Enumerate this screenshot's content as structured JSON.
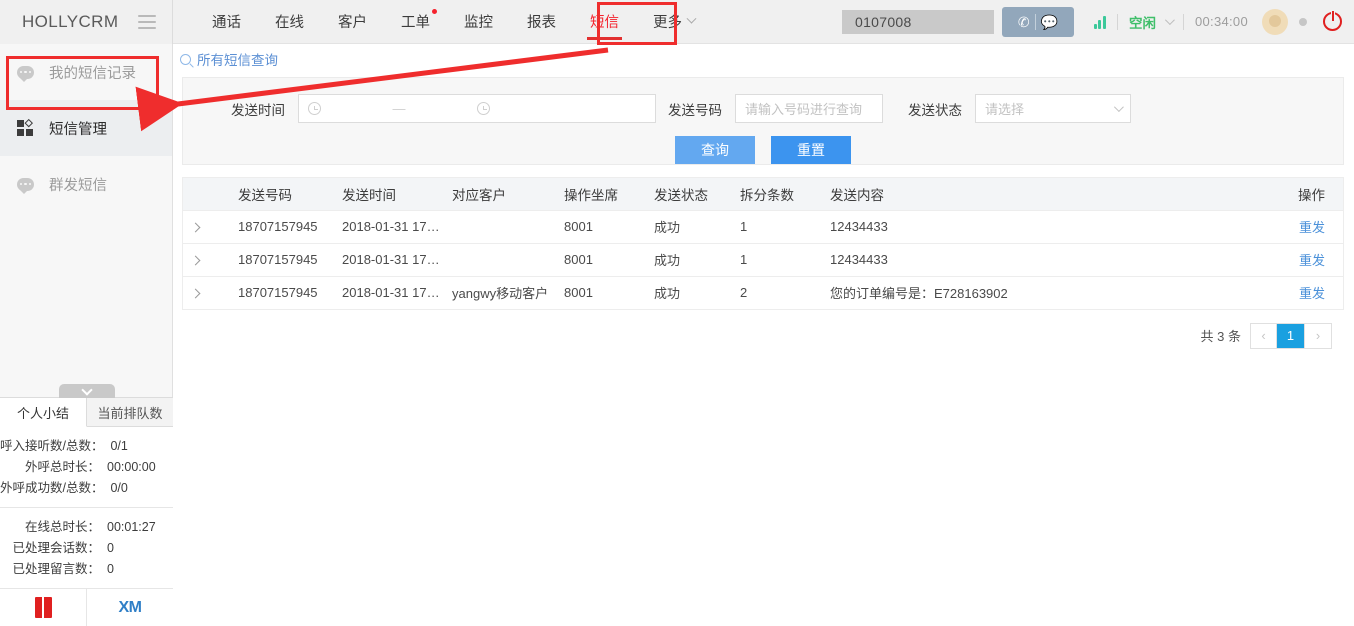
{
  "header": {
    "brand": "HOLLYCRM",
    "menu_icon": "hamburger-icon",
    "nav": [
      {
        "label": "通话",
        "active": false,
        "badge": false
      },
      {
        "label": "在线",
        "active": false,
        "badge": false
      },
      {
        "label": "客户",
        "active": false,
        "badge": false
      },
      {
        "label": "工单",
        "active": false,
        "badge": true
      },
      {
        "label": "监控",
        "active": false,
        "badge": false
      },
      {
        "label": "报表",
        "active": false,
        "badge": false
      },
      {
        "label": "短信",
        "active": true,
        "badge": false
      },
      {
        "label": "更多",
        "active": false,
        "badge": false
      }
    ],
    "extension": "0107008",
    "phone_icon": "phone-icon",
    "chat_icon": "chat-icon",
    "signal_icon": "wifi-signal-icon",
    "agent_status": "空闲",
    "timer": "00:34:00",
    "avatar": "user-avatar",
    "presence_dot": "presence-dot",
    "power_icon": "power-icon"
  },
  "sidebar": {
    "items": [
      {
        "label": "我的短信记录",
        "icon": "message-bubble-icon",
        "active": false
      },
      {
        "label": "短信管理",
        "icon": "grid-squares-icon",
        "active": true
      },
      {
        "label": "群发短信",
        "icon": "broadcast-bubble-icon",
        "active": false
      }
    ]
  },
  "breadcrumb": {
    "icon": "search-icon",
    "label": "所有短信查询"
  },
  "filter": {
    "time_label": "发送时间",
    "time_start_placeholder": "",
    "time_end_placeholder": "",
    "time_separator": "—",
    "number_label": "发送号码",
    "number_placeholder": "请输入号码进行查询",
    "number_value": "",
    "status_label": "发送状态",
    "status_placeholder": "请选择",
    "status_value": "",
    "query_button": "查询",
    "reset_button": "重置"
  },
  "table": {
    "columns": [
      "",
      "发送号码",
      "发送时间",
      "对应客户",
      "操作坐席",
      "发送状态",
      "拆分条数",
      "发送内容",
      "操作"
    ],
    "rows": [
      {
        "expand": "chevron-right",
        "number": "18707157945",
        "time": "2018-01-31 17:1...",
        "customer": "",
        "seat": "8001",
        "status": "成功",
        "split": "1",
        "content": "12434433",
        "action": "重发"
      },
      {
        "expand": "chevron-right",
        "number": "18707157945",
        "time": "2018-01-31 17:1...",
        "customer": "",
        "seat": "8001",
        "status": "成功",
        "split": "1",
        "content": "12434433",
        "action": "重发"
      },
      {
        "expand": "chevron-right",
        "number": "18707157945",
        "time": "2018-01-31 17:0...",
        "customer": "yangwy移动客户",
        "seat": "8001",
        "status": "成功",
        "split": "2",
        "content": "您的订单编号是：E728163902",
        "action": "重发"
      }
    ]
  },
  "pagination": {
    "total_text": "共 3 条",
    "prev": "‹",
    "current_page": "1",
    "next": "›"
  },
  "bottom_panel": {
    "toggle_icon": "collapse-caret-icon",
    "tabs": [
      {
        "label": "个人小结",
        "active": true
      },
      {
        "label": "当前排队数",
        "active": false
      }
    ],
    "stats_group1": [
      {
        "label": "呼入接听数/总数：",
        "value": "0/1"
      },
      {
        "label": "外呼总时长：",
        "value": "00:00:00"
      },
      {
        "label": "外呼成功数/总数：",
        "value": "0/0"
      }
    ],
    "stats_group2": [
      {
        "label": "在线总时长：",
        "value": "00:01:27"
      },
      {
        "label": "已处理会话数：",
        "value": "0"
      },
      {
        "label": "已处理留言数：",
        "value": "0"
      }
    ],
    "footer_icons": [
      {
        "name": "red-book-icon",
        "label": ""
      },
      {
        "name": "xm-logo-icon",
        "label": "XM"
      }
    ]
  },
  "annotations": {
    "accent_color": "#ef2d2d",
    "box_tab": "短信",
    "box_sidebar": "短信管理",
    "arrow": "red-arrow-from-tab-to-sidebar"
  }
}
